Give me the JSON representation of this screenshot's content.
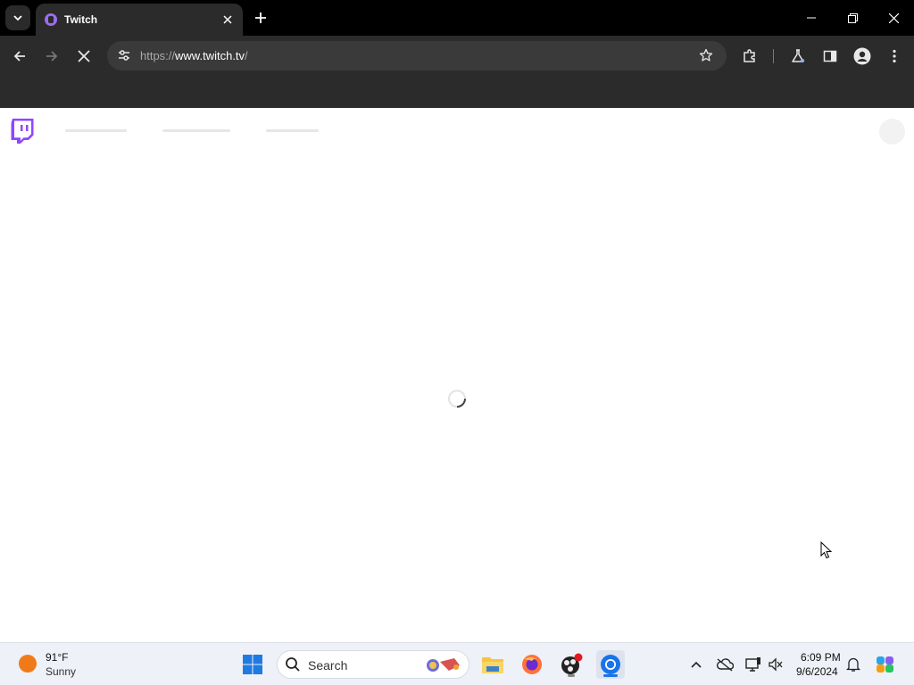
{
  "browser": {
    "tab": {
      "title": "Twitch"
    },
    "url": {
      "prefix": "https://",
      "host": "www.twitch.tv",
      "path": "/"
    }
  },
  "page": {
    "state": "loading"
  },
  "taskbar": {
    "weather": {
      "temp": "91°F",
      "condition": "Sunny"
    },
    "search_label": "Search",
    "clock": {
      "time": "6:09 PM",
      "date": "9/6/2024"
    }
  },
  "colors": {
    "twitch_purple": "#9146ff",
    "chrome_dark": "#2b2b2b",
    "taskbar": "#eef1f7"
  }
}
